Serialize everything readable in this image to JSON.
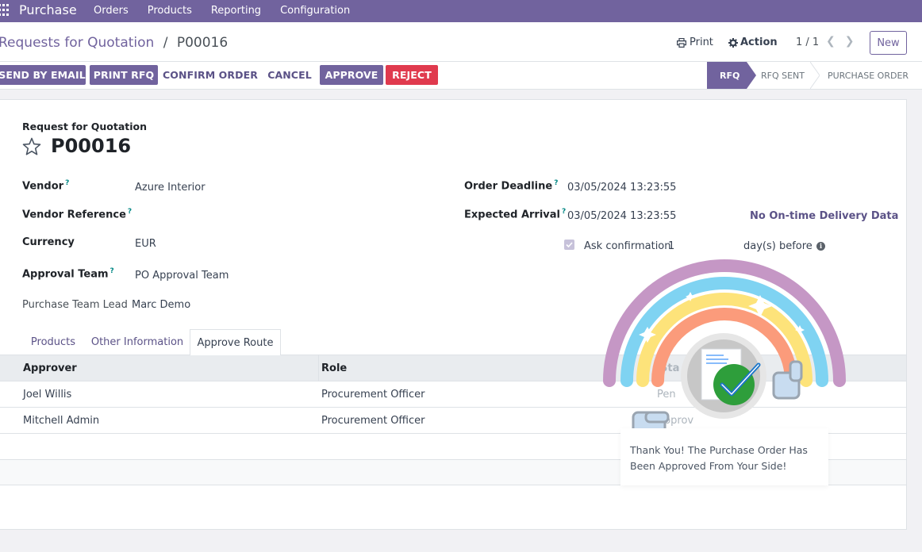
{
  "navbar": {
    "app_name": "Purchase",
    "menu": [
      "Orders",
      "Products",
      "Reporting",
      "Configuration"
    ]
  },
  "control_panel": {
    "breadcrumb_parent": "Requests for Quotation",
    "breadcrumb_separator": "/",
    "breadcrumb_current": "P00016",
    "print_label": "Print",
    "action_label": "Action",
    "pager": "1 / 1",
    "new_label": "New"
  },
  "statusbar": {
    "buttons": {
      "send_by_email": "SEND BY EMAIL",
      "print_rfq": "PRINT RFQ",
      "confirm_order": "CONFIRM ORDER",
      "cancel": "CANCEL",
      "approve": "APPROVE",
      "reject": "REJECT"
    },
    "stages": {
      "rfq": "RFQ",
      "rfq_sent": "RFQ SENT",
      "purchase_order": "PURCHASE ORDER"
    },
    "active_stage": "RFQ"
  },
  "form": {
    "subtitle": "Request for Quotation",
    "title": "P00016",
    "fields": {
      "vendor_label": "Vendor",
      "vendor_value": "Azure Interior",
      "vendor_ref_label": "Vendor Reference",
      "vendor_ref_value": "",
      "currency_label": "Currency",
      "currency_value": "EUR",
      "approval_team_label": "Approval Team",
      "approval_team_value": "PO Approval Team",
      "team_lead_label": "Purchase Team Lead",
      "team_lead_value": "Marc Demo",
      "order_deadline_label": "Order Deadline",
      "order_deadline_value": "03/05/2024 13:23:55",
      "expected_arrival_label": "Expected Arrival",
      "expected_arrival_value": "03/05/2024 13:23:55",
      "on_time_delivery": "No On-time Delivery Data",
      "ask_confirmation_label": "Ask confirmation",
      "ask_confirmation_days": "1",
      "days_before": "day(s) before",
      "help_marker": "?"
    },
    "tabs": {
      "products": "Products",
      "other_info": "Other Information",
      "approve_route": "Approve Route"
    },
    "table": {
      "headers": {
        "approver": "Approver",
        "role": "Role",
        "status_partial": "Sta"
      },
      "rows": [
        {
          "approver": "Joel Willis",
          "role": "Procurement Officer",
          "status_partial": "Pen"
        },
        {
          "approver": "Mitchell Admin",
          "role": "Procurement Officer",
          "status_partial": "Approv"
        }
      ]
    }
  },
  "popup": {
    "message": "Thank You! The Purchase Order Has Been Approved From Your Side!",
    "colors": {
      "arc_outer": "#c597c5",
      "arc_2": "#7fd3f2",
      "arc_3": "#fde37a",
      "arc_inner": "#fb9b7b",
      "check_green": "#2e9e3b",
      "check_blue": "#1b76c9"
    }
  },
  "colors": {
    "brand": "#71639e",
    "danger": "#e03a4e",
    "link": "#5b5287"
  }
}
